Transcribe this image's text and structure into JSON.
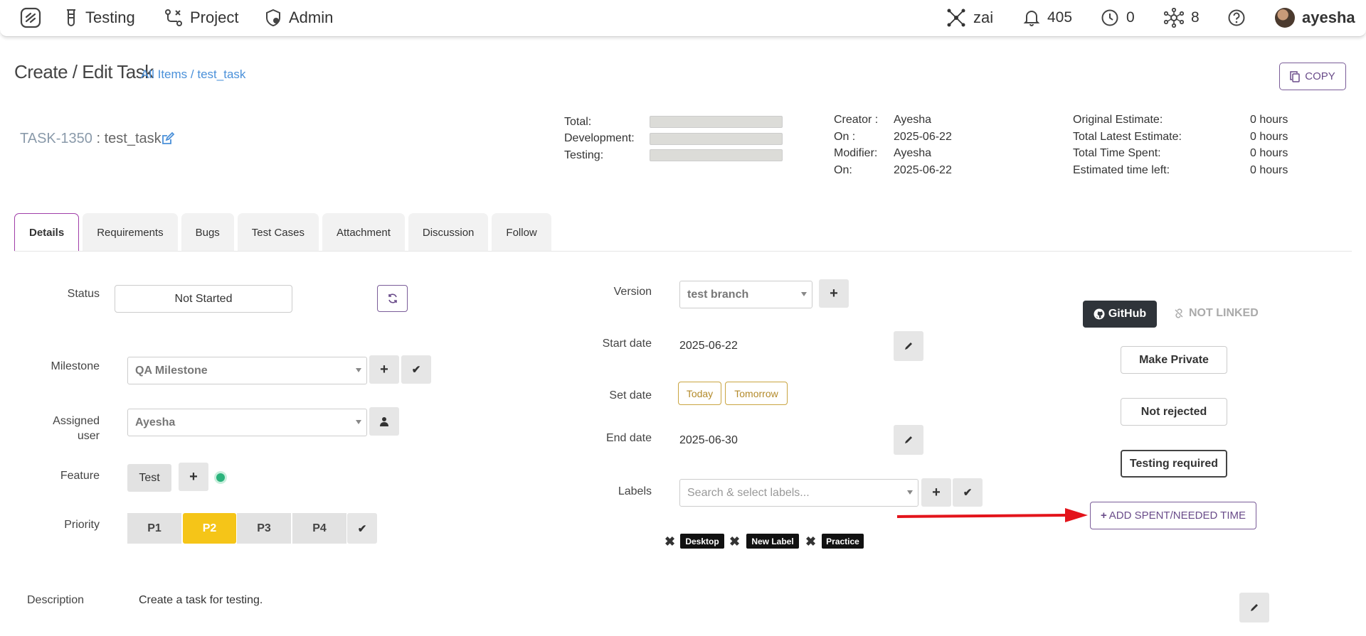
{
  "nav": {
    "testing": "Testing",
    "project": "Project",
    "admin": "Admin",
    "workspace": "zai",
    "notifications": "405",
    "timers": "0",
    "integrations": "8",
    "user": "ayesha"
  },
  "header": {
    "title": "Create / Edit Task",
    "breadcrumb_all": "All Items",
    "breadcrumb_sep": " / ",
    "breadcrumb_item": "test_task",
    "copy_label": "COPY"
  },
  "task": {
    "id": "TASK-1350",
    "sep": " : ",
    "name": "test_task"
  },
  "progress": {
    "total": "Total:",
    "development": "Development:",
    "testing": "Testing:"
  },
  "meta": {
    "creator_k": "Creator :",
    "creator_v": "Ayesha",
    "on_k": "On :",
    "on_v": "2025-06-22",
    "modifier_k": "Modifier:",
    "modifier_v": "Ayesha",
    "on2_k": "On:",
    "on2_v": "2025-06-22"
  },
  "estimates": {
    "orig_k": "Original Estimate:",
    "orig_v": "0 hours",
    "latest_k": "Total Latest Estimate:",
    "latest_v": "0 hours",
    "spent_k": "Total Time Spent:",
    "spent_v": "0 hours",
    "left_k": "Estimated time left:",
    "left_v": "0 hours"
  },
  "tabs": [
    "Details",
    "Requirements",
    "Bugs",
    "Test Cases",
    "Attachment",
    "Discussion",
    "Follow"
  ],
  "fields": {
    "status_label": "Status",
    "status_value": "Not Started",
    "milestone_label": "Milestone",
    "milestone_value": "QA Milestone",
    "assigned_label_1": "Assigned",
    "assigned_label_2": "user",
    "assigned_value": "Ayesha",
    "feature_label": "Feature",
    "feature_value": "Test",
    "priority_label": "Priority",
    "priorities": [
      "P1",
      "P2",
      "P3",
      "P4"
    ],
    "priority_selected": "P2",
    "version_label": "Version",
    "version_value": "test branch",
    "start_label": "Start date",
    "start_value": "2025-06-22",
    "setdate_label": "Set date",
    "today": "Today",
    "tomorrow": "Tomorrow",
    "end_label": "End date",
    "end_value": "2025-06-30",
    "labels_label": "Labels",
    "labels_placeholder": "Search & select labels...",
    "labels": [
      "Desktop",
      "New Label",
      "Practice"
    ]
  },
  "side": {
    "github": "GitHub",
    "not_linked": "NOT LINKED",
    "make_private": "Make Private",
    "not_rejected": "Not rejected",
    "testing_required": "Testing required",
    "add_time": "ADD SPENT/NEEDED TIME"
  },
  "description": {
    "label": "Description",
    "text": "Create a task for testing."
  },
  "colors": {
    "accent": "#7a5c98",
    "priority_active": "#f5c518",
    "annotation_arrow": "#e3141b"
  }
}
